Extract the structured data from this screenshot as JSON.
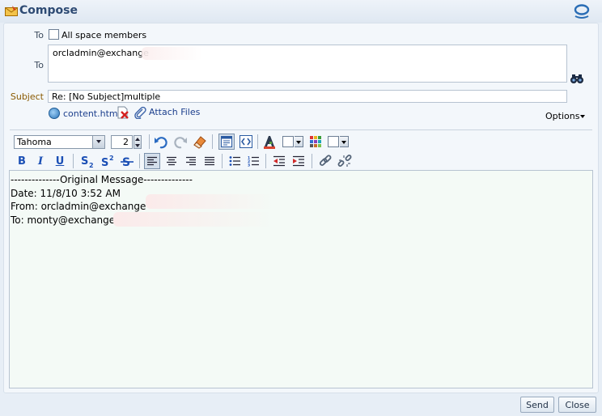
{
  "header": {
    "title": "Compose"
  },
  "to": {
    "label": "To",
    "all_members_label": "All space members",
    "value": "orcladmin@exchange"
  },
  "subject": {
    "label": "Subject",
    "value": "Re: [No Subject]multiple"
  },
  "attachments": {
    "file_name": "content.html",
    "attach_label": "Attach Files",
    "options_label": "Options"
  },
  "toolbar": {
    "font": "Tahoma",
    "size": "2",
    "bold": "B",
    "italic": "I",
    "underline": "U"
  },
  "message": {
    "lines": [
      "--------------Original Message--------------",
      "Date: 11/8/10 3:52 AM",
      "From: orcladmin@exchange",
      "To: monty@exchange"
    ]
  },
  "buttons": {
    "send": "Send",
    "close": "Close"
  },
  "colors": {
    "accent": "#2d4a73",
    "link": "#1b3e8c",
    "editor_bg": "#f4faf6"
  }
}
